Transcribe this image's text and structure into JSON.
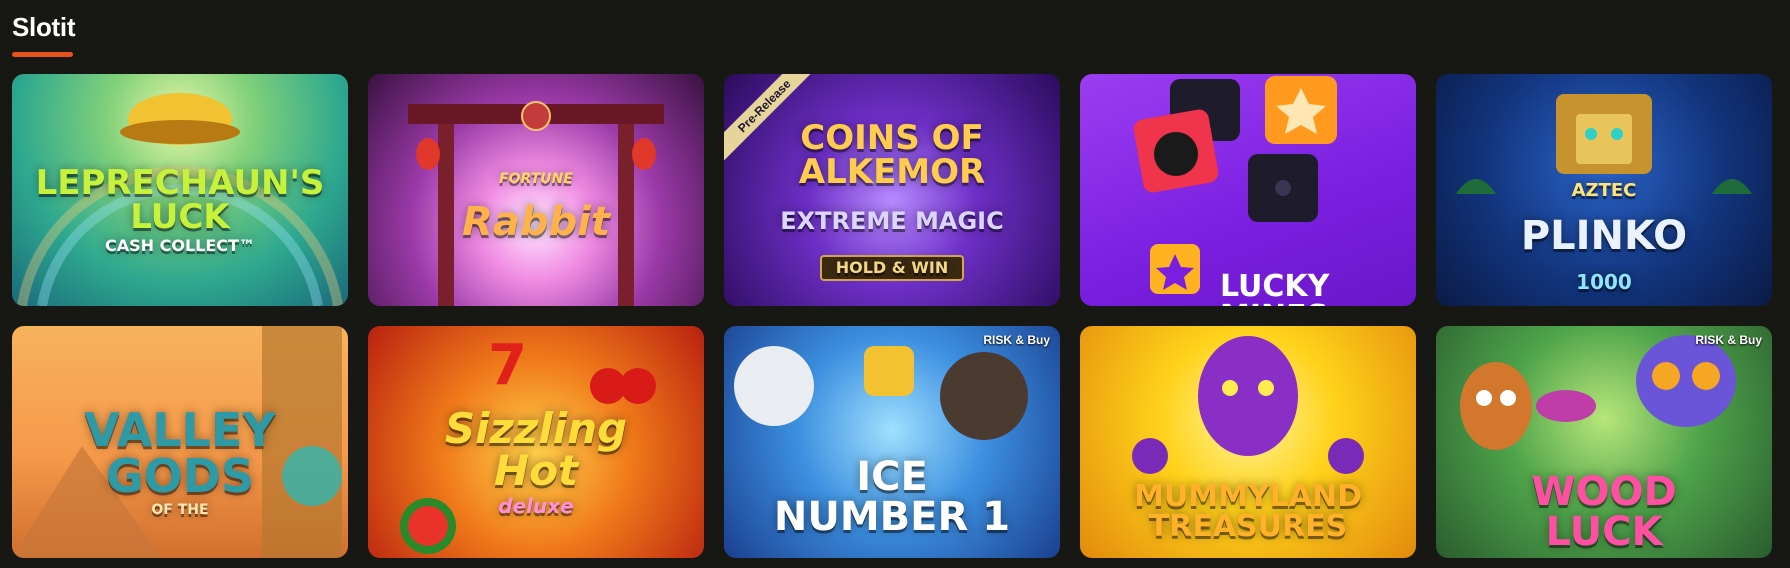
{
  "section": {
    "title": "Slotit"
  },
  "colors": {
    "background": "#171814",
    "accent": "#e8521e"
  },
  "games": [
    {
      "title": "LEPRECHAUN'S\nLUCK",
      "subtitle": "CASH COLLECT™"
    },
    {
      "title": "Rabbit",
      "subtitle": "FORTUNE"
    },
    {
      "title": "COINS OF\nALKEMOR",
      "subtitle": "EXTREME MAGIC",
      "chip": "HOLD & WIN",
      "badge": "Pre-Release"
    },
    {
      "title": "LUCKY\nMINES"
    },
    {
      "title": "PLINKO",
      "subtitle": "AZTEC",
      "chip": "1000"
    },
    {
      "title": "VALLEY\nGODS",
      "subtitle": "OF THE"
    },
    {
      "title": "Sizzling\nHot",
      "subtitle": "deluxe"
    },
    {
      "title": "ICE\nNUMBER 1",
      "badge": "RISK & Buy"
    },
    {
      "title": "MUMMYLAND\nTREASURES"
    },
    {
      "title": "WOOD\nLUCK",
      "badge": "RISK & Buy"
    }
  ]
}
